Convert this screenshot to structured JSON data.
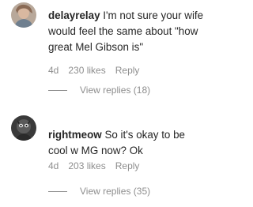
{
  "comments": [
    {
      "username": "delayrelay",
      "text": "I'm not sure your wife would feel the same about \"how great Mel Gibson is\"",
      "age": "4d",
      "likes": "230 likes",
      "reply_label": "Reply",
      "view_replies": "View replies (18)"
    },
    {
      "username": "rightmeow",
      "text": "So it's okay to be cool w MG now? Ok",
      "age": "4d",
      "likes": "203 likes",
      "reply_label": "Reply",
      "view_replies": "View replies (35)"
    }
  ],
  "colors": {
    "text": "#262626",
    "secondary": "#8e8e8e",
    "background": "#ffffff"
  },
  "icons": [
    "avatar-photo",
    "avatar-photo"
  ]
}
